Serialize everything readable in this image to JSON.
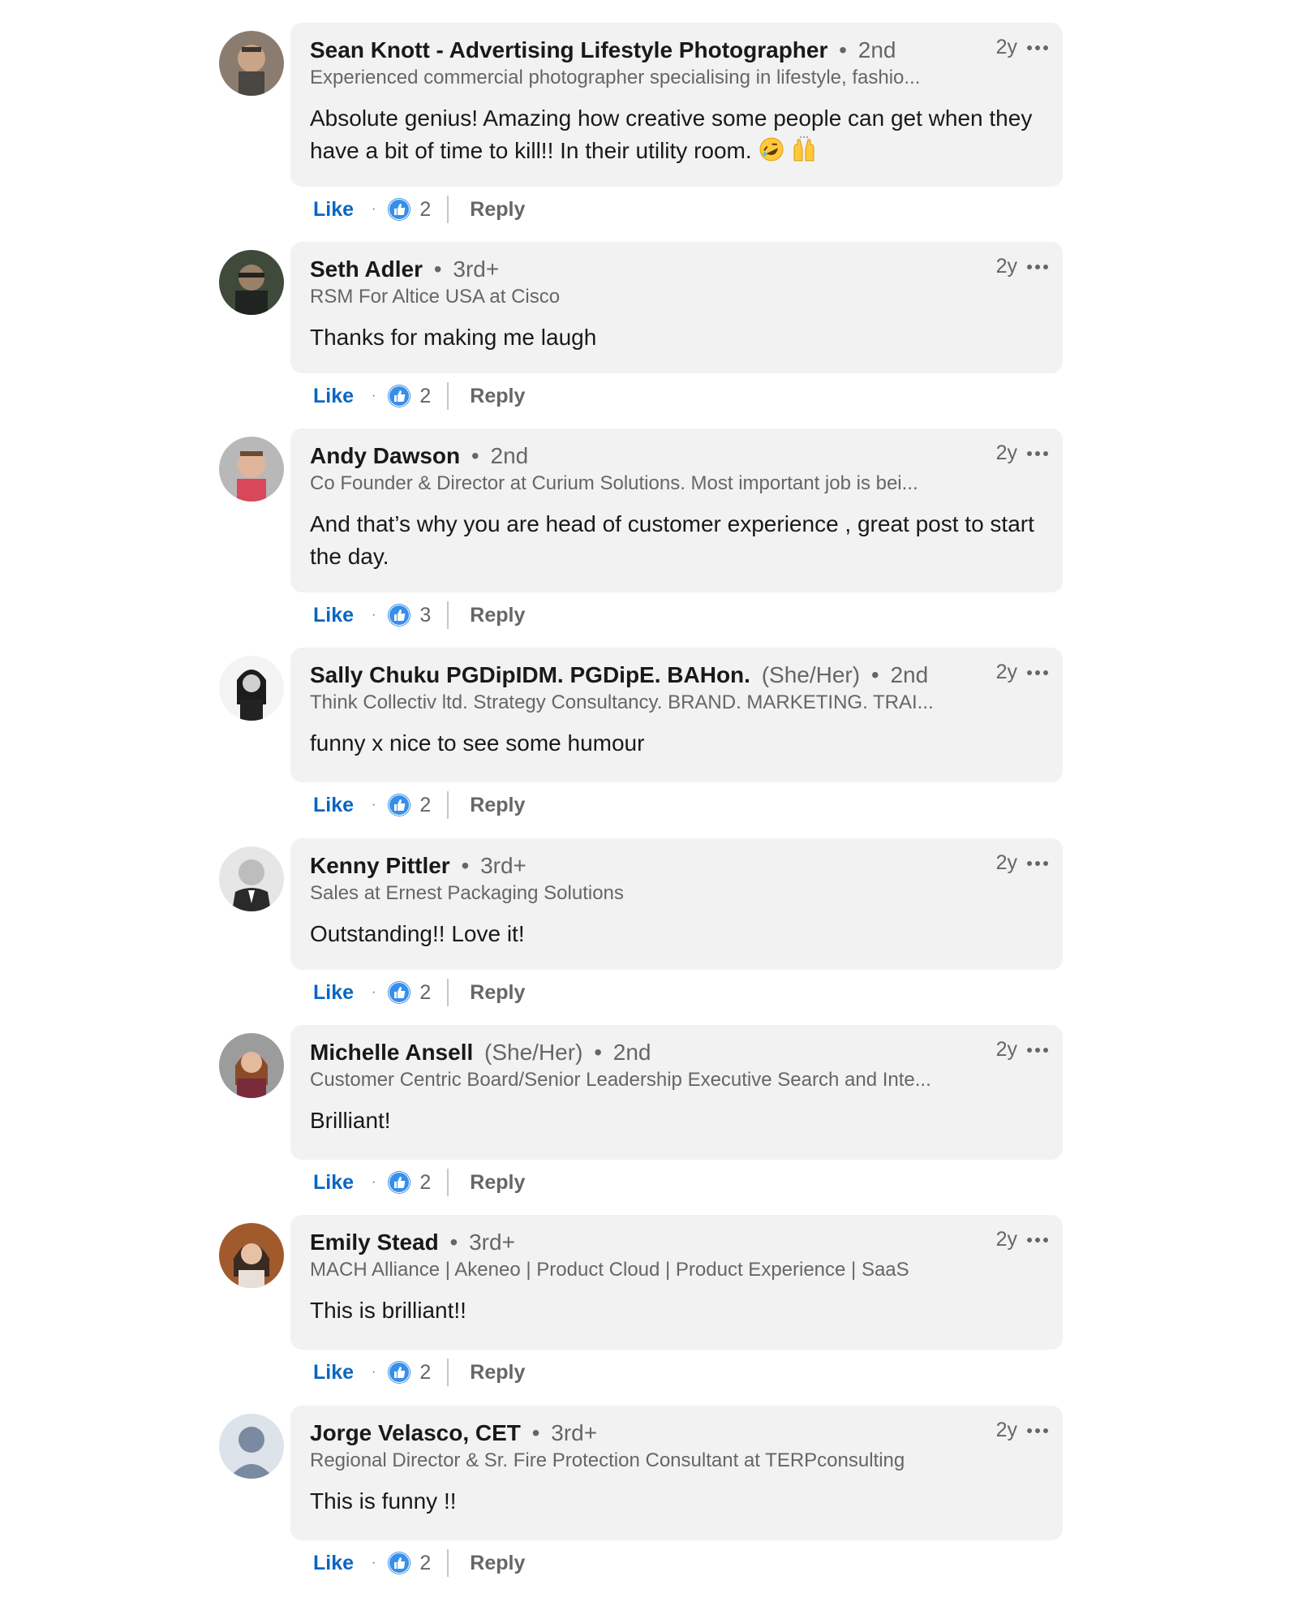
{
  "colors": {
    "link_blue": "#0a66c2",
    "bubble_bg": "#f2f2f2",
    "secondary_text": "#666666"
  },
  "comments": [
    {
      "name": "Sean Knott - Advertising Lifestyle Photographer",
      "pronouns": "",
      "degree": "2nd",
      "headline": "Experienced commercial photographer specialising in lifestyle, fashio...",
      "text": "Absolute genius! Amazing how creative some people can get when they have a bit of time to kill!! In their utility room.",
      "emojis": [
        "rolling-on-floor-laughing-emoji",
        "raising-hands-emoji"
      ],
      "time": "2y",
      "like_label": "Like",
      "reaction_icon": "thumbs-up-icon",
      "reactions": "2",
      "reply_label": "Reply"
    },
    {
      "name": "Seth Adler",
      "pronouns": "",
      "degree": "3rd+",
      "headline": "RSM For Altice USA at Cisco",
      "text": "Thanks for making me laugh",
      "time": "2y",
      "like_label": "Like",
      "reaction_icon": "thumbs-up-icon",
      "reactions": "2",
      "reply_label": "Reply"
    },
    {
      "name": "Andy Dawson",
      "pronouns": "",
      "degree": "2nd",
      "headline": "Co Founder & Director at Curium Solutions. Most important job is bei...",
      "text": "And that’s why you are head of customer experience , great post to start the day.",
      "time": "2y",
      "like_label": "Like",
      "reaction_icon": "thumbs-up-icon",
      "reactions": "3",
      "reply_label": "Reply"
    },
    {
      "name": "Sally Chuku PGDipIDM. PGDipE. BAHon.",
      "pronouns": "(She/Her)",
      "degree": "2nd",
      "headline": "Think Collectiv ltd. Strategy Consultancy. BRAND. MARKETING. TRAI...",
      "text": "funny x nice to see some humour",
      "time": "2y",
      "like_label": "Like",
      "reaction_icon": "thumbs-up-icon",
      "reactions": "2",
      "reply_label": "Reply"
    },
    {
      "name": "Kenny Pittler",
      "pronouns": "",
      "degree": "3rd+",
      "headline": "Sales at Ernest Packaging Solutions",
      "text": "Outstanding!! Love it!",
      "time": "2y",
      "like_label": "Like",
      "reaction_icon": "thumbs-up-icon",
      "reactions": "2",
      "reply_label": "Reply"
    },
    {
      "name": "Michelle Ansell",
      "pronouns": "(She/Her)",
      "degree": "2nd",
      "headline": "Customer Centric Board/Senior Leadership Executive Search and Inte...",
      "text": "Brilliant!",
      "time": "2y",
      "like_label": "Like",
      "reaction_icon": "thumbs-up-icon",
      "reactions": "2",
      "reply_label": "Reply"
    },
    {
      "name": "Emily Stead",
      "pronouns": "",
      "degree": "3rd+",
      "headline": "MACH Alliance | Akeneo | Product Cloud | Product Experience | SaaS",
      "text": "This is brilliant!!",
      "time": "2y",
      "like_label": "Like",
      "reaction_icon": "thumbs-up-icon",
      "reactions": "2",
      "reply_label": "Reply"
    },
    {
      "name": "Jorge Velasco, CET",
      "pronouns": "",
      "degree": "3rd+",
      "headline": "Regional Director & Sr. Fire Protection Consultant at TERPconsulting",
      "text": "This is funny !!",
      "time": "2y",
      "like_label": "Like",
      "reaction_icon": "thumbs-up-icon",
      "reactions": "2",
      "reply_label": "Reply"
    }
  ]
}
